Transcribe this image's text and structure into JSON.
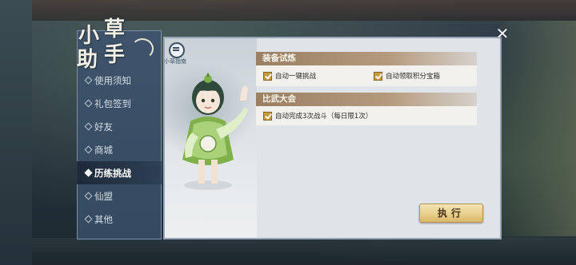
{
  "sidebar": {
    "title_chars": [
      "小",
      "草",
      "助",
      "手"
    ],
    "items": [
      {
        "label": "使用须知",
        "active": false
      },
      {
        "label": "礼包签到",
        "active": false
      },
      {
        "label": "好友",
        "active": false
      },
      {
        "label": "商城",
        "active": false
      },
      {
        "label": "历练挑战",
        "active": true
      },
      {
        "label": "仙盟",
        "active": false
      },
      {
        "label": "其他",
        "active": false
      }
    ]
  },
  "panel": {
    "helper_label": "小草指南",
    "sections": [
      {
        "title": "装备试炼",
        "options": [
          {
            "label": "自动一键挑战",
            "checked": true
          },
          {
            "label": "自动领取积分宝箱",
            "checked": true
          }
        ]
      },
      {
        "title": "比武大会",
        "options": [
          {
            "label": "自动完成3次战斗（每日限1次）",
            "checked": true
          }
        ]
      }
    ],
    "execute_label": "执行",
    "close_symbol": "✕"
  },
  "colors": {
    "checkbox": "#c89a3f",
    "section_header": "#9a7f63",
    "sidebar": "#3f546c",
    "button": "#e7cf8c"
  },
  "icons": [
    "close-icon",
    "helper-guide-icon",
    "checkbox-checked-icon",
    "diamond-bullet-icon"
  ]
}
